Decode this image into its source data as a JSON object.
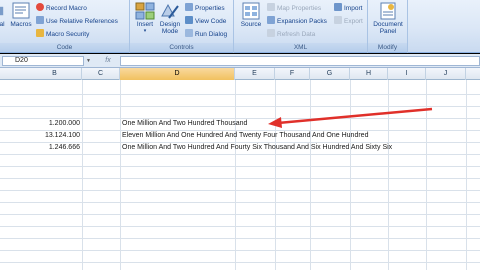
{
  "ribbon": {
    "code": {
      "label": "Code",
      "visual_basic": "al",
      "macros": "Macros",
      "record_macro": "Record Macro",
      "relative_refs": "Use Relative References",
      "macro_security": "Macro Security"
    },
    "controls": {
      "label": "Controls",
      "insert": "Insert",
      "design_mode": "Design Mode",
      "properties": "Properties",
      "view_code": "View Code",
      "run_dialog": "Run Dialog"
    },
    "xml": {
      "label": "XML",
      "source": "Source",
      "map_properties": "Map Properties",
      "expansion_packs": "Expansion Packs",
      "refresh_data": "Refresh Data",
      "import": "Import",
      "export": "Export"
    },
    "modify": {
      "label": "Modify",
      "document_panel": "Document Panel"
    }
  },
  "formula_bar": {
    "name_box": "D20",
    "fx": "fx",
    "formula": ""
  },
  "grid": {
    "columns": [
      "B",
      "C",
      "D",
      "E",
      "F",
      "G",
      "H",
      "I",
      "J"
    ],
    "active_column": "D",
    "rows": [
      {
        "b": "1.200.000",
        "d": "One Million And Two Hundred Thousand"
      },
      {
        "b": "13.124.100",
        "d": "Eleven Million And One Hundred And Twenty Four Thousand And One Hundred"
      },
      {
        "b": "1.246.666",
        "d": "One Million And Two Hundred And Fourty Six Thousand And Six Hundred And Sixty Six"
      }
    ]
  },
  "colors": {
    "annotation_arrow": "#e0302a",
    "ribbon_text": "#15428b",
    "active_header": "#f1c15f"
  }
}
